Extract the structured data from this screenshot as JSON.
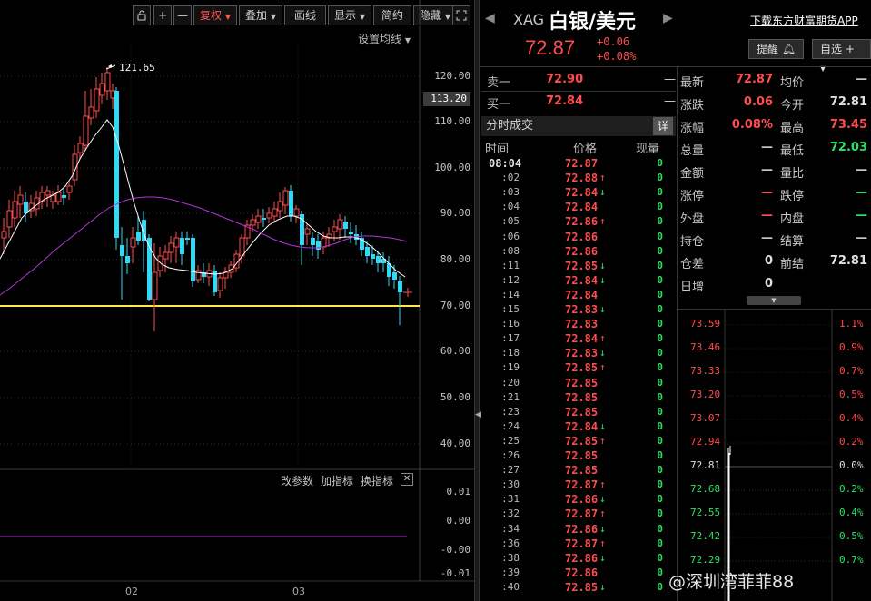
{
  "toolbar": {
    "buttons": [
      "+",
      "—",
      "复权",
      "叠加",
      "画线",
      "显示",
      "简约",
      "隐藏"
    ],
    "active": "复权"
  },
  "chart": {
    "setting_ma": "设置均线",
    "peak_label": "121.65",
    "current_tag": "113.20",
    "y_labels": [
      "120.00",
      "110.00",
      "100.00",
      "90.00",
      "80.00",
      "70.00",
      "60.00",
      "50.00",
      "40.00"
    ],
    "indicator_buttons": [
      "改参数",
      "加指标",
      "换指标"
    ],
    "ind_y_labels": [
      "0.01",
      "0.00",
      "-0.00",
      "-0.01"
    ],
    "x_labels": [
      "02",
      "03"
    ]
  },
  "header": {
    "symbol": "XAG",
    "name": "白银/美元",
    "price": "72.87",
    "change": "+0.06",
    "change_pct": "+0.08%",
    "app_link": "下载东方财富期货APP",
    "remind_button": "提醒",
    "watchlist_button": "自选"
  },
  "orderbook": {
    "sell_label": "卖一",
    "sell_price": "72.90",
    "sell_vol": "—",
    "buy_label": "买一",
    "buy_price": "72.84",
    "buy_vol": "—"
  },
  "history": {
    "title": "分时成交",
    "detail_button": "详",
    "headers": [
      "时间",
      "价格",
      "现量"
    ],
    "rows": [
      {
        "t": "08:04",
        "p": "72.87",
        "a": "",
        "v": "0"
      },
      {
        "t": ":02",
        "p": "72.88",
        "a": "up",
        "v": "0"
      },
      {
        "t": ":03",
        "p": "72.84",
        "a": "down",
        "v": "0"
      },
      {
        "t": ":04",
        "p": "72.84",
        "a": "",
        "v": "0"
      },
      {
        "t": ":05",
        "p": "72.86",
        "a": "up",
        "v": "0"
      },
      {
        "t": ":06",
        "p": "72.86",
        "a": "",
        "v": "0"
      },
      {
        "t": ":08",
        "p": "72.86",
        "a": "",
        "v": "0"
      },
      {
        "t": ":11",
        "p": "72.85",
        "a": "down",
        "v": "0"
      },
      {
        "t": ":12",
        "p": "72.84",
        "a": "down",
        "v": "0"
      },
      {
        "t": ":14",
        "p": "72.84",
        "a": "",
        "v": "0"
      },
      {
        "t": ":15",
        "p": "72.83",
        "a": "down",
        "v": "0"
      },
      {
        "t": ":16",
        "p": "72.83",
        "a": "",
        "v": "0"
      },
      {
        "t": ":17",
        "p": "72.84",
        "a": "up",
        "v": "0"
      },
      {
        "t": ":18",
        "p": "72.83",
        "a": "down",
        "v": "0"
      },
      {
        "t": ":19",
        "p": "72.85",
        "a": "up",
        "v": "0"
      },
      {
        "t": ":20",
        "p": "72.85",
        "a": "",
        "v": "0"
      },
      {
        "t": ":21",
        "p": "72.85",
        "a": "",
        "v": "0"
      },
      {
        "t": ":23",
        "p": "72.85",
        "a": "",
        "v": "0"
      },
      {
        "t": ":24",
        "p": "72.84",
        "a": "down",
        "v": "0"
      },
      {
        "t": ":25",
        "p": "72.85",
        "a": "up",
        "v": "0"
      },
      {
        "t": ":26",
        "p": "72.85",
        "a": "",
        "v": "0"
      },
      {
        "t": ":27",
        "p": "72.85",
        "a": "",
        "v": "0"
      },
      {
        "t": ":30",
        "p": "72.87",
        "a": "up",
        "v": "0"
      },
      {
        "t": ":31",
        "p": "72.86",
        "a": "down",
        "v": "0"
      },
      {
        "t": ":32",
        "p": "72.87",
        "a": "up",
        "v": "0"
      },
      {
        "t": ":34",
        "p": "72.86",
        "a": "down",
        "v": "0"
      },
      {
        "t": ":36",
        "p": "72.87",
        "a": "up",
        "v": "0"
      },
      {
        "t": ":38",
        "p": "72.86",
        "a": "down",
        "v": "0"
      },
      {
        "t": ":39",
        "p": "72.86",
        "a": "",
        "v": "0"
      },
      {
        "t": ":40",
        "p": "72.85",
        "a": "down",
        "v": "0"
      }
    ]
  },
  "quote": {
    "rows": [
      {
        "l1": "最新",
        "v1": "72.87",
        "c1": "#ff4c4c",
        "l2": "均价",
        "v2": "—",
        "c2": "#c8c8c8"
      },
      {
        "l1": "涨跌",
        "v1": "0.06",
        "c1": "#ff4c4c",
        "l2": "今开",
        "v2": "72.81",
        "c2": "#e0e0e0"
      },
      {
        "l1": "涨幅",
        "v1": "0.08%",
        "c1": "#ff4c4c",
        "l2": "最高",
        "v2": "73.45",
        "c2": "#ff4c4c"
      },
      {
        "l1": "总量",
        "v1": "—",
        "c1": "#c8c8c8",
        "l2": "最低",
        "v2": "72.03",
        "c2": "#2ee062"
      },
      {
        "l1": "金额",
        "v1": "—",
        "c1": "#c8c8c8",
        "l2": "量比",
        "v2": "—",
        "c2": "#c8c8c8"
      },
      {
        "l1": "涨停",
        "v1": "—",
        "c1": "#ff4c4c",
        "l2": "跌停",
        "v2": "—",
        "c2": "#2ee062"
      },
      {
        "l1": "外盘",
        "v1": "—",
        "c1": "#ff4c4c",
        "l2": "内盘",
        "v2": "—",
        "c2": "#2ee062"
      },
      {
        "l1": "持仓",
        "v1": "—",
        "c1": "#c8c8c8",
        "l2": "结算",
        "v2": "—",
        "c2": "#c8c8c8"
      },
      {
        "l1": "仓差",
        "v1": "0",
        "c1": "#e0e0e0",
        "l2": "前结",
        "v2": "72.81",
        "c2": "#e0e0e0"
      },
      {
        "l1": "日增",
        "v1": "0",
        "c1": "#e0e0e0",
        "l2": "",
        "v2": "",
        "c2": "#c8c8c8"
      }
    ]
  },
  "mini_chart": {
    "left": [
      "73.59",
      "73.46",
      "73.33",
      "73.20",
      "73.07",
      "72.94",
      "72.81",
      "72.68",
      "72.55",
      "72.42",
      "72.29"
    ],
    "right": [
      "1.1%",
      "0.9%",
      "0.7%",
      "0.5%",
      "0.4%",
      "0.2%",
      "0.0%",
      "0.2%",
      "0.4%",
      "0.5%",
      "0.7%"
    ]
  },
  "watermark": "@深圳湾菲菲88",
  "colors": {
    "up": "#ff4c4c",
    "down": "#2ee062",
    "candle_down": "#31d9f5",
    "ma_white": "#ffffff",
    "ma_purple": "#b035d8",
    "support": "#ffe74c"
  }
}
